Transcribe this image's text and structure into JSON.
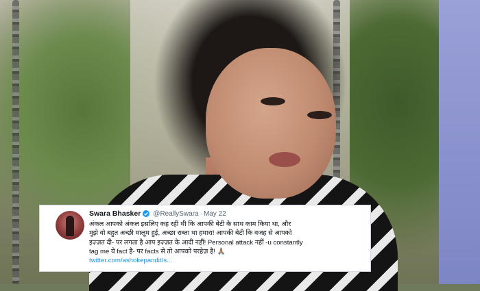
{
  "tweet": {
    "author_name": "Swara Bhasker",
    "handle": "@ReallySwara",
    "separator": "·",
    "date": "May 22",
    "lines": [
      "अंकल आपको अंकल इसलिए कह रही थी कि आपकी बेटी के साथ काम किया था, और",
      "मुझे वो बहुत अच्छी मालूम हुई, अच्छा राब्ता था हमारा! आपकी बेटी कि वजह से आपको",
      "इज़्ज़त दी- पर लगता है आप इज़्ज़त के आदी नहीं! Personal attack नहीं -u constantly",
      "tag me ये fact है- पर facts से तो आपको परहेज़ है! 🙏🏽"
    ],
    "link": "twitter.com/ashokepandit/s..."
  },
  "colors": {
    "link": "#1b95e0",
    "verified_badge": "#1d9bf0",
    "text": "#0f1419",
    "muted": "#536471"
  },
  "icons": {
    "verified": "verified-badge-icon",
    "avatar": "profile-avatar"
  }
}
